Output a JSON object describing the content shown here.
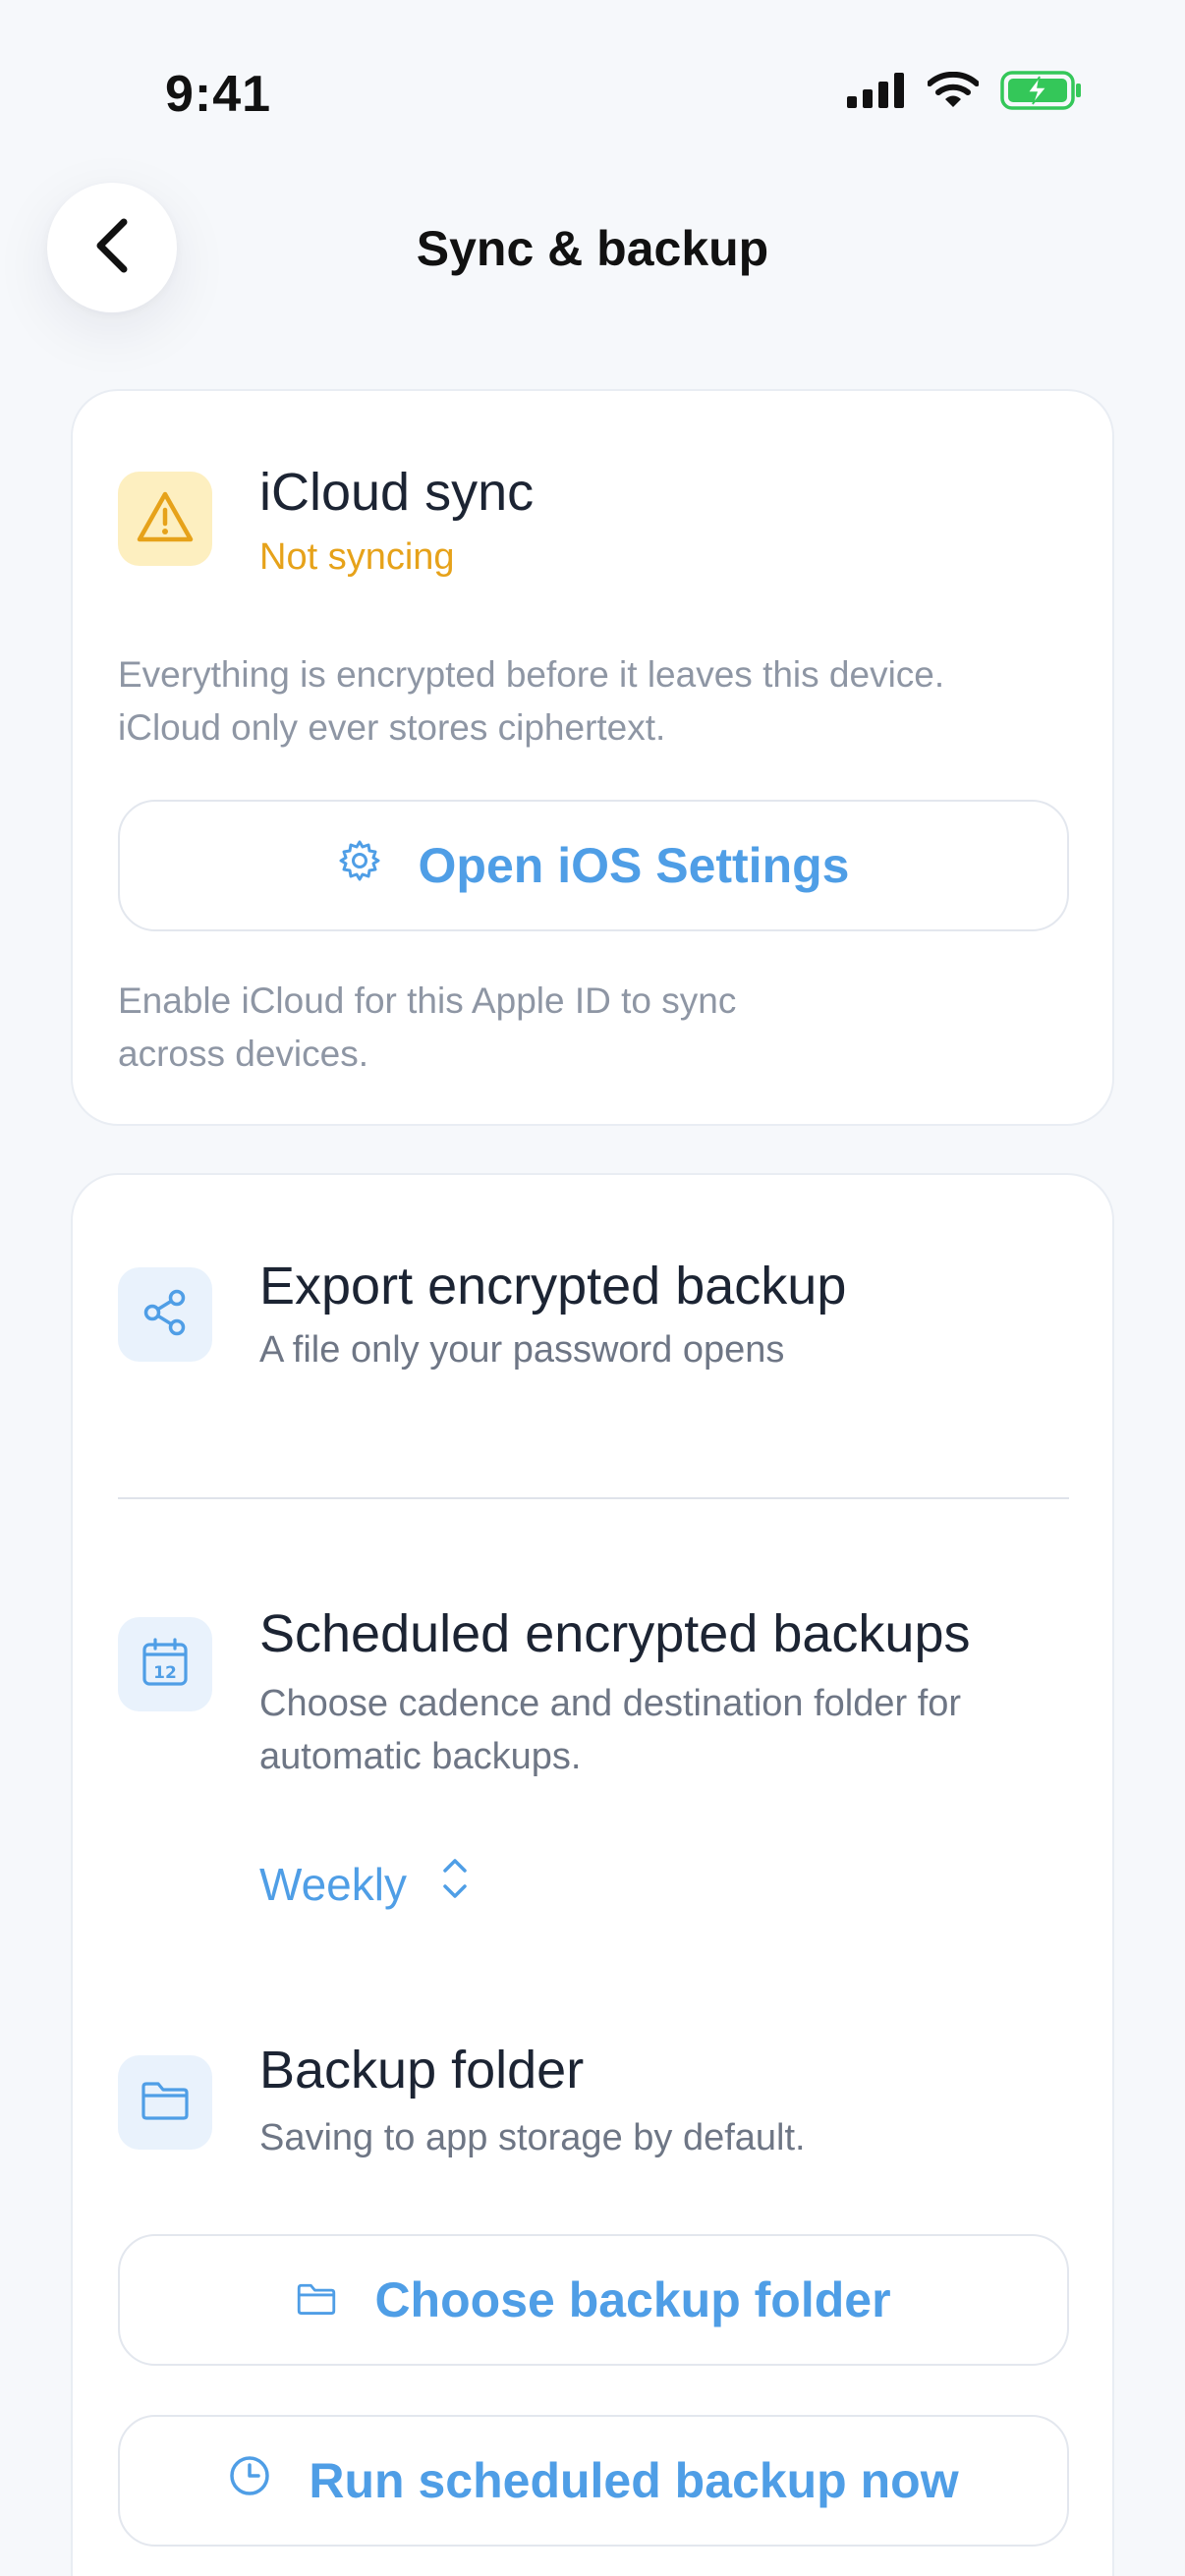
{
  "status_bar": {
    "time": "9:41"
  },
  "header": {
    "title": "Sync & backup"
  },
  "icloud": {
    "title": "iCloud sync",
    "status": "Not syncing",
    "description_line1": "Everything is encrypted before it leaves this device.",
    "description_line2": "iCloud only ever stores ciphertext.",
    "button_label": "Open iOS Settings",
    "hint_line1": "Enable iCloud for this Apple ID to sync",
    "hint_line2": "across devices."
  },
  "export": {
    "title": "Export encrypted backup",
    "subtitle": "A file only your password opens"
  },
  "scheduled": {
    "title": "Scheduled encrypted backups",
    "subtitle_line1": "Choose cadence and destination folder for",
    "subtitle_line2": "automatic backups.",
    "cadence": "Weekly"
  },
  "folder": {
    "title": "Backup folder",
    "subtitle": "Saving to app storage by default.",
    "choose_label": "Choose backup folder",
    "run_label": "Run scheduled backup now"
  },
  "colors": {
    "accent": "#4f9ee6",
    "warning": "#e6a21a",
    "battery": "#34c759"
  }
}
